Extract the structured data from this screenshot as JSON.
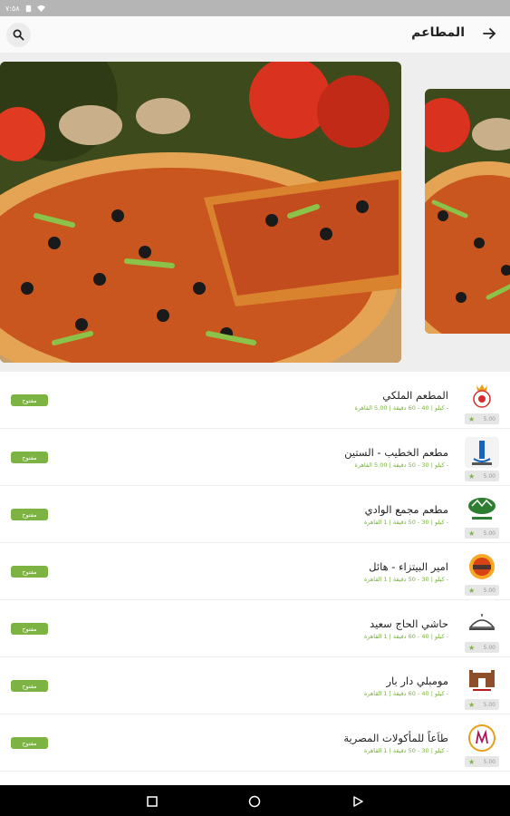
{
  "status_bar": {
    "time": "٧:٥٨"
  },
  "header": {
    "title": "المطاعم"
  },
  "restaurants": [
    {
      "name": "المطعم الملكي",
      "meta": "- كيلو | 40 - 60 دقيقة | 5.00 القاهرة",
      "rating": "5.00",
      "status": "مفتوح"
    },
    {
      "name": "مطعم الخطيب - الستين",
      "meta": "- كيلو | 30 - 50 دقيقة | 5.00 القاهرة",
      "rating": "5.00",
      "status": "مفتوح"
    },
    {
      "name": "مطعم مجمع الوادي",
      "meta": "- كيلو | 30 - 50 دقيقة | 1 القاهرة",
      "rating": "5.00",
      "status": "مفتوح"
    },
    {
      "name": "امير البيتزاء - هائل",
      "meta": "- كيلو | 30 - 50 دقيقة | 1 القاهرة",
      "rating": "5.00",
      "status": "مفتوح"
    },
    {
      "name": "حاشي الحاج سعيد",
      "meta": "- كيلو | 40 - 60 دقيقة | 1 القاهرة",
      "rating": "5.00",
      "status": "مفتوح"
    },
    {
      "name": "مومبلي دار بار",
      "meta": "- كيلو | 40 - 60 دقيقة | 1 القاهرة",
      "rating": "5.00",
      "status": "مفتوح"
    },
    {
      "name": "طاَعاً للمأكولات المصرية",
      "meta": "- كيلو | 30 - 50 دقيقة | 1 القاهرة",
      "rating": "5.00",
      "status": "مفتوح"
    }
  ],
  "icons": {
    "back": "arrow-right-icon",
    "search": "search-icon",
    "rating": "star-icon"
  },
  "colors": {
    "accent": "#7cb342",
    "status_bar": "#b5b5b5",
    "nav_bar": "#000000"
  }
}
